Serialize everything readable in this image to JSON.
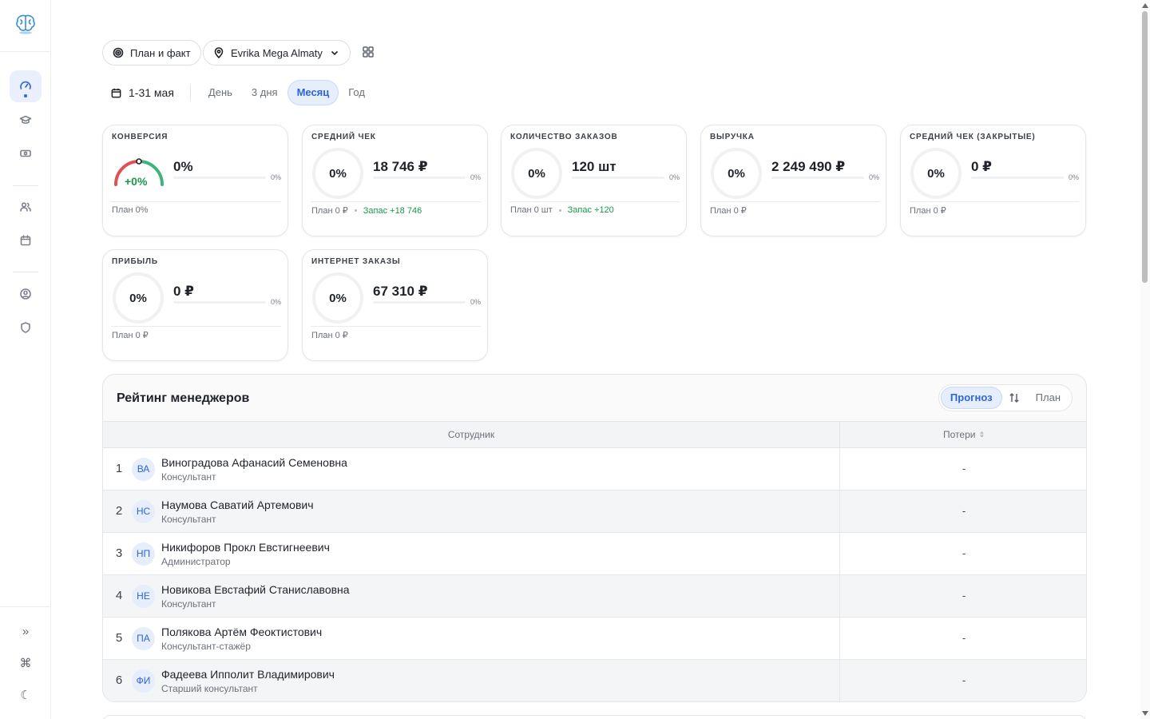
{
  "filters": {
    "mode_label": "План и факт",
    "store_label": "Evrika Mega Almaty"
  },
  "period": {
    "range": "1-31 мая",
    "tabs": [
      "День",
      "3 дня",
      "Месяц",
      "Год"
    ],
    "active": "Месяц"
  },
  "kpis": {
    "conversion": {
      "title": "КОНВЕРСИЯ",
      "delta": "+0%",
      "value": "0%",
      "pct": "0%",
      "plan": "План 0%"
    },
    "avg_check": {
      "title": "СРЕДНИЙ ЧЕК",
      "ring": "0%",
      "value": "18 746 ₽",
      "pct": "0%",
      "plan": "План 0 ₽",
      "reserve": "Запас +18 746"
    },
    "orders": {
      "title": "КОЛИЧЕСТВО ЗАКАЗОВ",
      "ring": "0%",
      "value": "120 шт",
      "pct": "0%",
      "plan": "План 0 шт",
      "reserve": "Запас +120"
    },
    "revenue": {
      "title": "ВЫРУЧКА",
      "ring": "0%",
      "value": "2 249 490 ₽",
      "pct": "0%",
      "plan": "План 0 ₽"
    },
    "avg_check_closed": {
      "title": "СРЕДНИЙ ЧЕК (ЗАКРЫТЫЕ)",
      "ring": "0%",
      "value": "0 ₽",
      "pct": "0%",
      "plan": "План 0 ₽"
    },
    "profit": {
      "title": "ПРИБЫЛЬ",
      "ring": "0%",
      "value": "0 ₽",
      "pct": "0%",
      "plan": "План 0 ₽"
    },
    "online_orders": {
      "title": "ИНТЕРНЕТ ЗАКАЗЫ",
      "ring": "0%",
      "value": "67 310 ₽",
      "pct": "0%",
      "plan": "План 0 ₽"
    }
  },
  "rating": {
    "title": "Рейтинг менеджеров",
    "toggle": {
      "forecast": "Прогноз",
      "plan": "План"
    },
    "columns": {
      "employee": "Сотрудник",
      "losses": "Потери"
    },
    "rows": [
      {
        "n": "1",
        "initials": "ВА",
        "name": "Виноградова Афанасий Семеновна",
        "role": "Консультант",
        "loss": "-"
      },
      {
        "n": "2",
        "initials": "НС",
        "name": "Наумова Саватий Артемович",
        "role": "Консультант",
        "loss": "-"
      },
      {
        "n": "3",
        "initials": "НП",
        "name": "Никифоров Прокл Евстигнеевич",
        "role": "Администратор",
        "loss": "-"
      },
      {
        "n": "4",
        "initials": "НЕ",
        "name": "Новикова Евстафий Станиславовна",
        "role": "Консультант",
        "loss": "-"
      },
      {
        "n": "5",
        "initials": "ПА",
        "name": "Полякова Артём Феоктистович",
        "role": "Консультант-стажёр",
        "loss": "-"
      },
      {
        "n": "6",
        "initials": "ФИ",
        "name": "Фадеева Ипполит Владимирович",
        "role": "Старший консультант",
        "loss": "-"
      }
    ]
  },
  "sidebar": {
    "items": [
      "dashboard-icon",
      "graduation-cap-icon",
      "cash-icon",
      "users-icon",
      "calendar-icon",
      "user-circle-icon",
      "shield-icon"
    ],
    "bottom": {
      "expand": "»",
      "command": "⌘",
      "theme": "☾"
    }
  },
  "colors": {
    "accent": "#2d64d8",
    "success": "#1a9a4a",
    "gauge_red": "#e05252",
    "gauge_green": "#3fb37a"
  }
}
